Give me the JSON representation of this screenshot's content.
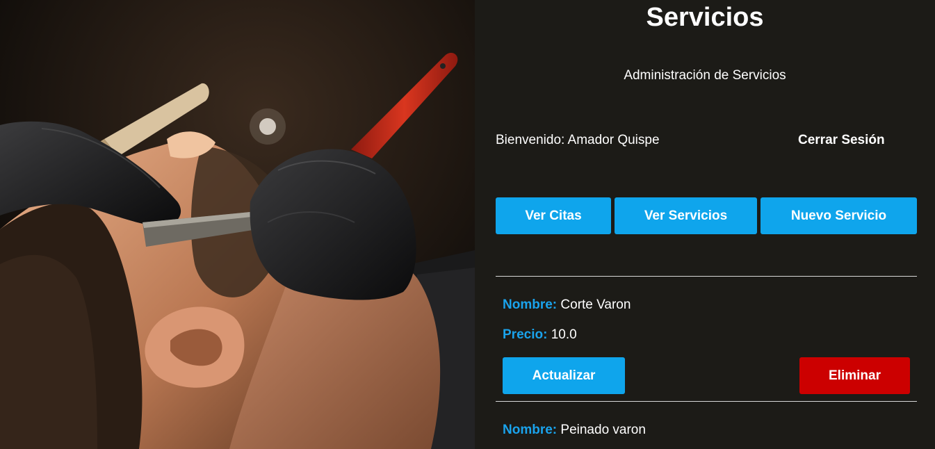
{
  "page": {
    "title": "Servicios",
    "subtitle": "Administración de Servicios"
  },
  "session": {
    "welcome_text": "Bienvenido: Amador Quispe",
    "logout_label": "Cerrar Sesión"
  },
  "nav": {
    "ver_citas": "Ver Citas",
    "ver_servicios": "Ver Servicios",
    "nuevo_servicio": "Nuevo Servicio"
  },
  "labels": {
    "nombre": "Nombre:",
    "precio": "Precio:",
    "actualizar": "Actualizar",
    "eliminar": "Eliminar"
  },
  "services": [
    {
      "nombre": "Corte Varon",
      "precio": "10.0"
    },
    {
      "nombre": "Peinado varon"
    }
  ],
  "colors": {
    "background": "#1c1b17",
    "accent_blue": "#0fa5ec",
    "label_blue": "#1aa3ec",
    "danger_red": "#cc0000"
  },
  "hero_image": {
    "icon": "barber-shaving-photo"
  }
}
